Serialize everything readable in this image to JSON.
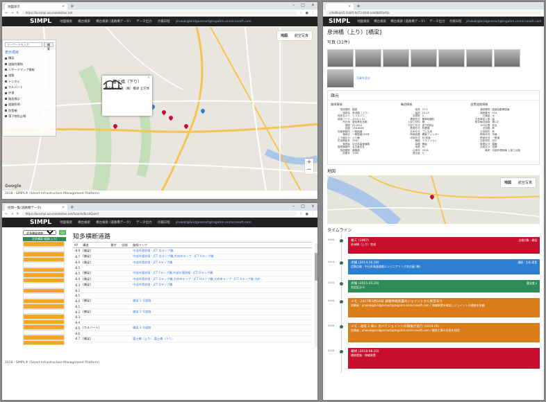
{
  "colors": {
    "appbar": "#212121",
    "red": "#c8102e",
    "blue": "#2d7fd3",
    "green": "#2e8b57",
    "orange": "#d97c1a",
    "span_orange": "#f5a623"
  },
  "browser": {
    "w1": {
      "tab": "地図表示",
      "url": "https://bcsimpl.azurewebsites.net"
    },
    "w2": {
      "tab": "径間一覧(道路橋データ)",
      "url": "https://bcsimpl.azurewebsites.net/Search/BcsitQuest"
    },
    "w3": {
      "url": "/c9d6ba/e5-0cbf0-9d73-4fd4-ade9b8f3ef4a"
    }
  },
  "appbar": {
    "brand": "SIMPL",
    "nav": [
      "地図検索",
      "橋台検索",
      "橋台検索 (道路橋データ)",
      "データ出力",
      "点検日程"
    ],
    "email": "yhakali@bridgesmart@tegahm.onmicrosoft.com"
  },
  "map": {
    "btn_map": "地図",
    "btn_satellite": "航空写真",
    "search_placeholder": "キーワードを入力",
    "search_button": "検索",
    "panel_title": "表示項目",
    "panel_items": [
      "橋梁",
      "道路附属物",
      "ハザードマップ情報",
      "道路",
      "トンネル",
      "カルバート",
      "歩道",
      "路面標示",
      "道路照明",
      "防雪柵",
      "落下物防止柵"
    ],
    "popup_title": "富士橋（下り）",
    "popup_sub": "構造物 : 市道（株）橋梁 立方体",
    "google": "Google"
  },
  "footer": "2018 - SIMPL® (Smart Infrastructure Management Platform)",
  "spans": {
    "select": "北多橋梁道路",
    "go": "Go",
    "header": "北多橋梁-道路(上り)",
    "title": "知多横断道路",
    "columns": [
      "KP",
      "構造",
      "番付",
      "径間",
      "路線リンク"
    ],
    "rows": [
      [
        "-8.9",
        "[橋梁]",
        "",
        "",
        "中部外環状線 - JCT 北ランプ橋"
      ],
      [
        "-8.7",
        "[橋梁]",
        "",
        "",
        "中部外環状線 - JCT 北ランプ橋,大府市ランプ - JCT Aランプ橋"
      ],
      [
        "-8.6",
        "[橋梁]",
        "",
        "",
        "中部外環状線 - JCT Aランプ橋"
      ],
      [
        "-8.5",
        "",
        "",
        "",
        ""
      ],
      [
        "-8.5",
        "[橋梁]",
        "",
        "",
        "中部外環状線 - JCT Fランプ橋,中部外環状線 - JCT Oランプ橋"
      ],
      [
        "-8.4",
        "[橋梁]",
        "",
        "",
        "中部外環状線 - JCT Gランプ橋,大府市ランプ - JCT Hランプ橋,大府市ランプ - JCT Aランプ橋,大府..."
      ],
      [
        "-8.3",
        "[橋梁]",
        "",
        "",
        "中部外環状線 - JCT Dランプ橋"
      ],
      [
        "-8.2",
        "",
        "",
        "",
        ""
      ],
      [
        "-8.1",
        "",
        "",
        "",
        ""
      ],
      [
        "-8.0",
        "[橋梁]",
        "",
        "",
        "橋梁 1 号道路"
      ],
      [
        "-8.1",
        "",
        "",
        "",
        ""
      ],
      [
        "-8.2",
        "[橋梁]",
        "",
        "",
        "橋梁 2 号道路"
      ],
      [
        "-8.3",
        "",
        "",
        "",
        ""
      ],
      [
        "-8.4",
        "",
        "",
        "",
        ""
      ],
      [
        "-8.5",
        "[カルバート]",
        "",
        "",
        "橋梁 3 号道路"
      ],
      [
        "-8.6",
        "",
        "",
        "",
        ""
      ],
      [
        "-8.7",
        "[橋梁]",
        "",
        "",
        "富士橋（上り）,富士橋（下り）"
      ]
    ]
  },
  "detail": {
    "title": "彦洲橋（上り）[橋梁]",
    "photos_label": "写真 (31件)",
    "photo_link": "写真を見る",
    "spec_title": "諸元",
    "spec_cols": [
      "路線情報",
      "構造情報",
      "設置道路情報"
    ],
    "spec_col1": [
      [
        "橋梁種別",
        "橋梁"
      ],
      [
        "橋梁名",
        "彦洲橋（上り）"
      ],
      [
        "橋梁名カナ",
        "ヒコスバシ"
      ],
      [
        "橋梁コード",
        "1023 1 01"
      ],
      [
        "所在地",
        "愛知県知多郡"
      ],
      [
        "緯度",
        "35.0521"
      ],
      [
        "経度",
        "136.8860"
      ],
      [
        "所管事務所",
        "一般国道"
      ],
      [
        "路線名",
        "一般国道155号"
      ],
      [
        "上下線区分",
        "上り線"
      ],
      [
        "供用開始年",
        "1987"
      ],
      [
        "管理者",
        "中日本高速道路"
      ],
      [
        "管理事務所",
        "名古屋支社"
      ],
      [
        "施設種別",
        "道路橋"
      ],
      [
        "設置年",
        "1985"
      ]
    ],
    "spec_col2": [
      [
        "橋長",
        "37.5"
      ],
      [
        "幅員",
        "10.25"
      ],
      [
        "支間数",
        "3"
      ],
      [
        "構造形式",
        "鋼単純箱桁"
      ],
      [
        "上部工材料",
        "鋼"
      ],
      [
        "下部工形式",
        "逆T式橋台"
      ],
      [
        "基礎形式",
        "杭基礎"
      ],
      [
        "支承形式",
        "ゴム支承"
      ],
      [
        "伸縮装置",
        "鋼製フィンガー"
      ],
      [
        "床版形式",
        "RC床版"
      ],
      [
        "舗装",
        "アスファルト"
      ],
      [
        "高欄",
        "鋼製"
      ],
      [
        "地覆",
        "RC"
      ],
      [
        "点検年",
        "2016"
      ],
      [
        "健全度",
        "II"
      ]
    ],
    "spec_col3": [
      [
        "道路種別",
        "高速自動車国道"
      ],
      [
        "路線番号",
        "E1A"
      ],
      [
        "交通量",
        "大"
      ],
      [
        "大型車混入率",
        "高"
      ],
      [
        "緊急輸送道路",
        "第1次"
      ],
      [
        "DID区間",
        "該当"
      ],
      [
        "迂回路",
        "有"
      ],
      [
        "占用物件",
        "有"
      ],
      [
        "跨線状況",
        "市道"
      ],
      [
        "跨道状況",
        "一般道"
      ],
      [
        "交差物件",
        "河川"
      ],
      [
        "管理区分",
        "直轄"
      ],
      [
        "点検区分",
        "定期"
      ],
      [
        "備考",
        "中部外環状線 上部工点検"
      ]
    ],
    "map_label": "地図",
    "map_btn_map": "地図",
    "map_btn_sat": "航空写真",
    "timeline_label": "タイムライン",
    "timeline": [
      {
        "year": "2016",
        "color": "#c8102e",
        "title": "竣工 (1987)",
        "body": "彦洲橋（上り）完成",
        "right": "点検対象 : 橋梁"
      },
      {
        "year": "2014",
        "color": "#2d7fd3",
        "title": "点検 (2014.10.28)",
        "body": "定期点検 : 中日本高速道路エンジニアリング名古屋 (株)",
        "right": "損傷 : 主桁 腐食"
      },
      {
        "year": "2015",
        "color": "#2e8b57",
        "title": "点検 (2015.03.20)",
        "body": "判定区分 II",
        "right": "健全度 II"
      },
      {
        "year": "2016",
        "color": "#d97c1a",
        "title": "メモ : 2017年3月19日 鋼製伸縮装置のジョイントから異音あり",
        "body": "投稿者 : yhakali@bridgesmart@tegahm.onmicrosoft.com / 伸縮装置を確認しジョイントの補修を依頼",
        "right": ""
      },
      {
        "year": "2018",
        "color": "#d97c1a",
        "title": "メモ : 通常 2 車に 比べてジョイントの損傷が進行 (2018.05)",
        "body": "投稿者 : yhakali@bridgesmart@tegahm.onmicrosoft.com / 補修工事の計画を検討",
        "right": ""
      },
      {
        "year": "2018",
        "color": "#c8102e",
        "title": "補修 (2018.08.03)",
        "body": "補修実施 : 伸縮装置",
        "right": ""
      }
    ]
  }
}
